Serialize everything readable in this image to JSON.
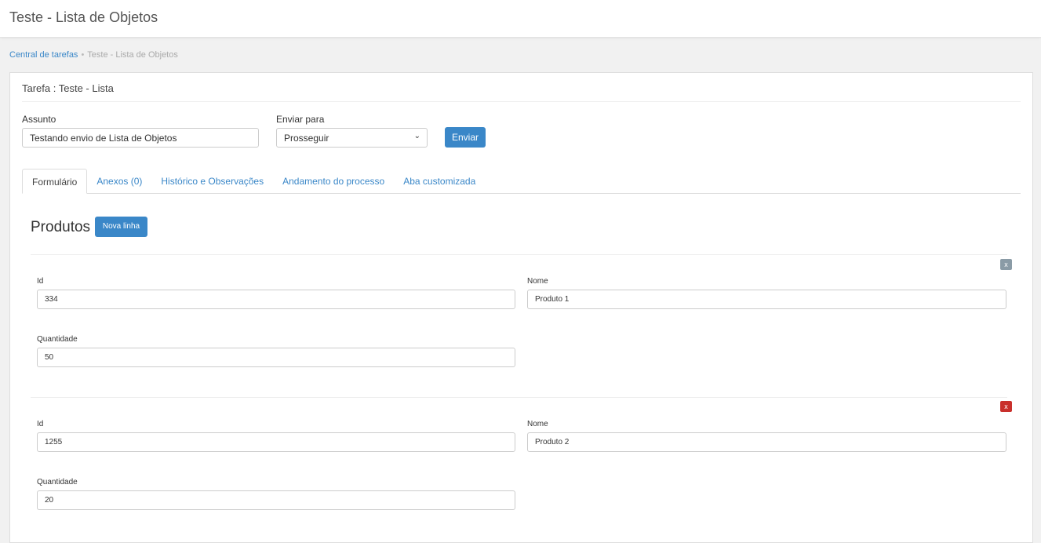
{
  "header": {
    "title": "Teste - Lista de Objetos"
  },
  "breadcrumb": {
    "home": "Central de tarefas",
    "current": "Teste - Lista de Objetos"
  },
  "task": {
    "title": "Tarefa : Teste - Lista",
    "subject_label": "Assunto",
    "subject_value": "Testando envio de Lista de Objetos",
    "send_to_label": "Enviar para",
    "send_to_value": "Prosseguir",
    "send_button": "Enviar"
  },
  "tabs": [
    "Formulário",
    "Anexos (0)",
    "Histórico e Observações",
    "Andamento do processo",
    "Aba customizada"
  ],
  "section": {
    "title": "Produtos",
    "new_row_button": "Nova linha"
  },
  "rows": [
    {
      "remove": "x",
      "id_label": "Id",
      "id": "334",
      "name_label": "Nome",
      "name": "Produto 1",
      "qty_label": "Quantidade",
      "qty": "50"
    },
    {
      "remove": "x",
      "id_label": "Id",
      "id": "1255",
      "name_label": "Nome",
      "name": "Produto 2",
      "qty_label": "Quantidade",
      "qty": "20"
    }
  ]
}
